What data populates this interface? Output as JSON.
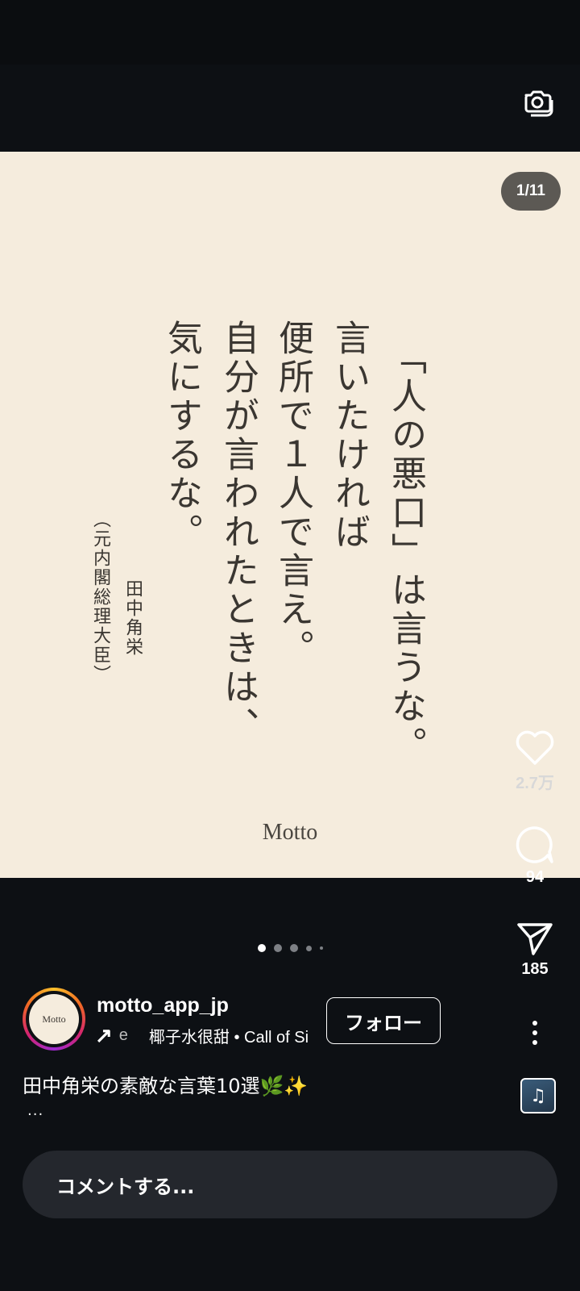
{
  "post": {
    "counter": "1/11",
    "quote_lines": [
      "「人の悪口」は言うな。",
      "言いたければ",
      "便所で１人で言え。",
      "自分が言われたときは、",
      "気にするな。"
    ],
    "author": "田中角栄",
    "author_title": "（元内閣総理大臣）",
    "brand": "Motto"
  },
  "actions": {
    "likes": "2.7万",
    "comments": "94",
    "shares": "185"
  },
  "user": {
    "username": "motto_app_jp",
    "avatar_text": "Motto",
    "follow_label": "フォロー",
    "music_arrow": "↗",
    "music_prefix": "e",
    "music_text": "椰子水很甜 • Call of Si"
  },
  "caption": "田中角栄の素敵な言葉10選🌿✨",
  "caption_more": "...",
  "comment_placeholder": "コメントする...",
  "icons": [
    "camera-icon",
    "heart-icon",
    "comment-icon",
    "send-icon",
    "more-vertical-icon",
    "music-note-icon"
  ]
}
